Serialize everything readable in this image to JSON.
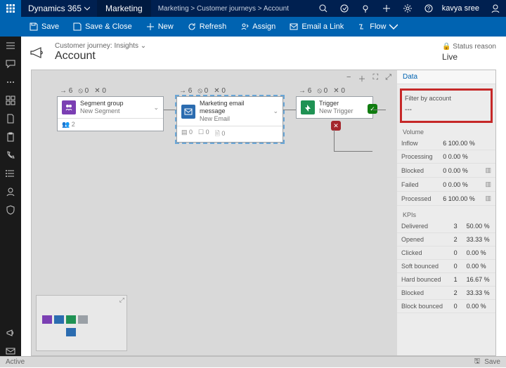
{
  "titlebar": {
    "app": "Dynamics 365",
    "module": "Marketing",
    "breadcrumbs": [
      "Marketing",
      "Customer journeys",
      "Account"
    ],
    "user": "kavya sree"
  },
  "commands": {
    "save": "Save",
    "save_close": "Save & Close",
    "new": "New",
    "refresh": "Refresh",
    "assign": "Assign",
    "email_link": "Email a Link",
    "flow": "Flow"
  },
  "page": {
    "subtitle": "Customer journey: Insights",
    "title": "Account",
    "status_label": "Status reason",
    "status_value": "Live"
  },
  "tiles": {
    "segment": {
      "stats": {
        "in": "6",
        "blocked": "0",
        "failed": "0"
      },
      "title": "Segment group",
      "subtitle": "New Segment",
      "subcount": "2",
      "color": "#7b3fb3"
    },
    "email": {
      "stats": {
        "in": "6",
        "blocked": "0",
        "failed": "0"
      },
      "title": "Marketing email message",
      "subtitle": "New Email",
      "sub": [
        "0",
        "0",
        "0"
      ],
      "color": "#2b6cb0"
    },
    "trigger": {
      "stats": {
        "in": "6",
        "blocked": "0",
        "failed": "0"
      },
      "title": "Trigger",
      "subtitle": "New Trigger",
      "color": "#1f9254"
    }
  },
  "data_panel": {
    "tab": "Data",
    "filter_label": "Filter by account",
    "filter_value": "---",
    "volume_title": "Volume",
    "kpi_title": "KPIs",
    "volume": [
      {
        "label": "Inflow",
        "value": "6 100.00 %"
      },
      {
        "label": "Processing",
        "value": "0 0.00 %"
      },
      {
        "label": "Blocked",
        "value": "0 0.00 %"
      },
      {
        "label": "Failed",
        "value": "0 0.00 %"
      },
      {
        "label": "Processed",
        "value": "6 100.00 %"
      }
    ],
    "kpis": [
      {
        "label": "Delivered",
        "count": "3",
        "pct": "50.00 %"
      },
      {
        "label": "Opened",
        "count": "2",
        "pct": "33.33 %"
      },
      {
        "label": "Clicked",
        "count": "0",
        "pct": "0.00 %"
      },
      {
        "label": "Soft bounced",
        "count": "0",
        "pct": "0.00 %"
      },
      {
        "label": "Hard bounced",
        "count": "1",
        "pct": "16.67 %"
      },
      {
        "label": "Blocked",
        "count": "2",
        "pct": "33.33 %"
      },
      {
        "label": "Block bounced",
        "count": "0",
        "pct": "0.00 %"
      }
    ]
  },
  "statusbar": {
    "left": "Active",
    "right": "Save"
  }
}
